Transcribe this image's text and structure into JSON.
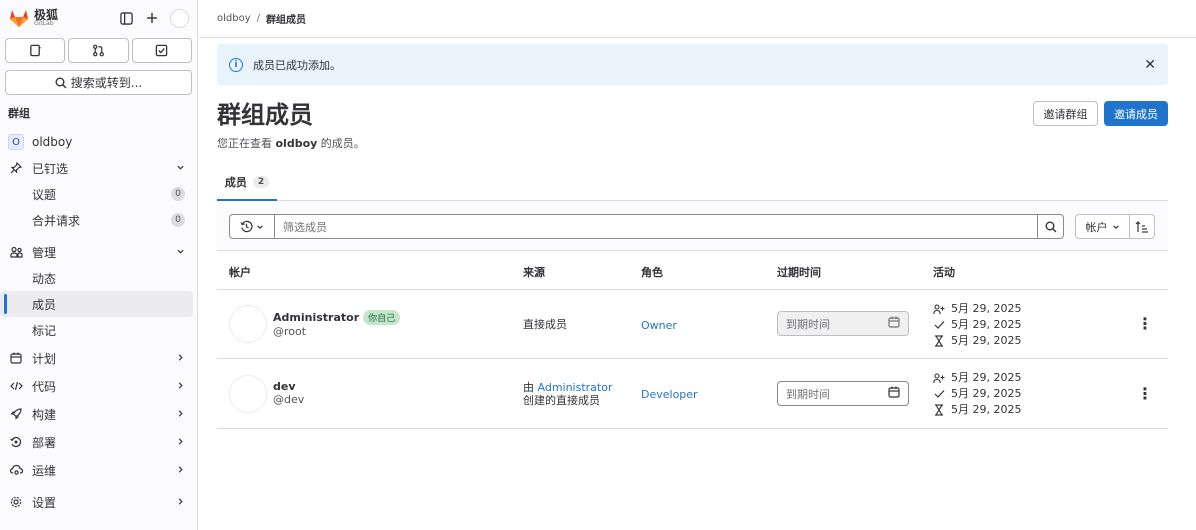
{
  "brand": {
    "title": "极狐",
    "sub": "GitLab"
  },
  "sidebar": {
    "search_label": "搜索或转到...",
    "section_title": "群组",
    "group": {
      "initial": "O",
      "name": "oldboy"
    },
    "pinned": {
      "label": "已钉选",
      "items": [
        {
          "label": "议题",
          "count": "0"
        },
        {
          "label": "合并请求",
          "count": "0"
        }
      ]
    },
    "manage": {
      "label": "管理",
      "items": [
        {
          "label": "动态"
        },
        {
          "label": "成员"
        },
        {
          "label": "标记"
        }
      ]
    },
    "plan": "计划",
    "code": "代码",
    "build": "构建",
    "deploy": "部署",
    "operate": "运维",
    "settings": "设置"
  },
  "breadcrumb": {
    "parent": "oldboy",
    "current": "群组成员"
  },
  "alert": {
    "message": "成员已成功添加。"
  },
  "page": {
    "title": "群组成员",
    "subtitle_prefix": "您正在查看 ",
    "subtitle_group": "oldboy",
    "subtitle_suffix": " 的成员。",
    "invite_group": "邀请群组",
    "invite_member": "邀请成员"
  },
  "tabs": [
    {
      "label": "成员",
      "count": "2"
    }
  ],
  "filter": {
    "placeholder": "筛选成员",
    "sort_label": "帐户"
  },
  "table": {
    "headers": {
      "account": "帐户",
      "source": "来源",
      "role": "角色",
      "expires": "过期时间",
      "activity": "活动"
    },
    "rows": [
      {
        "name": "Administrator",
        "badge": "你自己",
        "handle": "@root",
        "source": "直接成员",
        "role": "Owner",
        "expires_placeholder": "到期时间",
        "activity": [
          "5月 29, 2025",
          "5月 29, 2025",
          "5月 29, 2025"
        ]
      },
      {
        "name": "dev",
        "handle": "@dev",
        "source_prefix": "由 ",
        "source_link": "Administrator",
        "source_suffix": "创建的直接成员",
        "role": "Developer",
        "expires_placeholder": "到期时间",
        "activity": [
          "5月 29, 2025",
          "5月 29, 2025",
          "5月 29, 2025"
        ]
      }
    ]
  },
  "colors": {
    "accent": "#1f75cb",
    "alert_bg": "#e9f3fc",
    "badge_green": "#c3e6cd"
  }
}
